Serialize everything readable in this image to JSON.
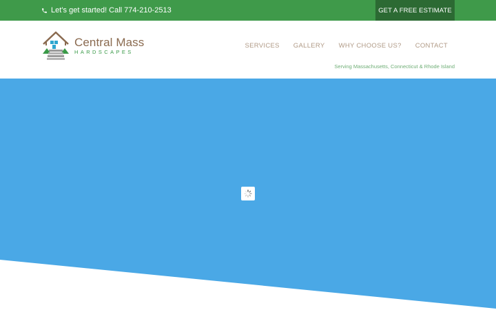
{
  "topbar": {
    "call_text": "Let’s get started! Call 774-210-2513",
    "estimate_label": "GET A FREE ESTIMATE"
  },
  "logo": {
    "name_main": "Central Mass",
    "name_sub": "HARDSCAPES"
  },
  "nav": {
    "items": [
      {
        "label": "SERVICES"
      },
      {
        "label": "GALLERY"
      },
      {
        "label": "WHY CHOOSE US?"
      },
      {
        "label": "CONTACT"
      }
    ]
  },
  "tagline": "Serving Massachusetts, Connecticut & Rhode Island",
  "colors": {
    "topbar_green": "#3f9a4a",
    "estimate_dark_green": "#2c6a33",
    "hero_blue": "#4aa8e6",
    "nav_text": "#b09a86",
    "logo_brown": "#8a6a4f",
    "logo_green": "#3a9a48"
  },
  "icons": {
    "phone": "phone-icon",
    "loader": "loading-spinner-icon"
  }
}
